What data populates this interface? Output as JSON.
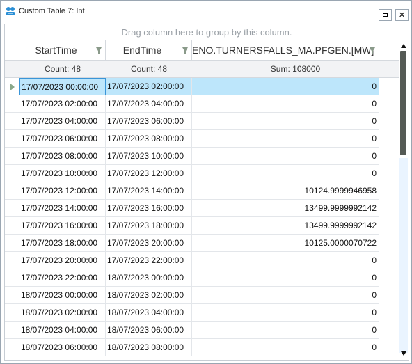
{
  "window": {
    "title": "Custom Table 7: Int",
    "close_glyph": "✕"
  },
  "grid": {
    "group_panel_text": "Drag column here to group by this column.",
    "columns": [
      {
        "label": "StartTime"
      },
      {
        "label": "EndTime"
      },
      {
        "label": "ENO.TURNERSFALLS_MA.PFGEN.[MW]"
      }
    ],
    "summary": [
      "Count: 48",
      "Count: 48",
      "Sum: 108000"
    ],
    "rows": [
      {
        "start": "17/07/2023 00:00:00",
        "end": "17/07/2023 02:00:00",
        "value": "0"
      },
      {
        "start": "17/07/2023 02:00:00",
        "end": "17/07/2023 04:00:00",
        "value": "0"
      },
      {
        "start": "17/07/2023 04:00:00",
        "end": "17/07/2023 06:00:00",
        "value": "0"
      },
      {
        "start": "17/07/2023 06:00:00",
        "end": "17/07/2023 08:00:00",
        "value": "0"
      },
      {
        "start": "17/07/2023 08:00:00",
        "end": "17/07/2023 10:00:00",
        "value": "0"
      },
      {
        "start": "17/07/2023 10:00:00",
        "end": "17/07/2023 12:00:00",
        "value": "0"
      },
      {
        "start": "17/07/2023 12:00:00",
        "end": "17/07/2023 14:00:00",
        "value": "10124.9999946958"
      },
      {
        "start": "17/07/2023 14:00:00",
        "end": "17/07/2023 16:00:00",
        "value": "13499.9999992142"
      },
      {
        "start": "17/07/2023 16:00:00",
        "end": "17/07/2023 18:00:00",
        "value": "13499.9999992142"
      },
      {
        "start": "17/07/2023 18:00:00",
        "end": "17/07/2023 20:00:00",
        "value": "10125.0000070722"
      },
      {
        "start": "17/07/2023 20:00:00",
        "end": "17/07/2023 22:00:00",
        "value": "0"
      },
      {
        "start": "17/07/2023 22:00:00",
        "end": "18/07/2023 00:00:00",
        "value": "0"
      },
      {
        "start": "18/07/2023 00:00:00",
        "end": "18/07/2023 02:00:00",
        "value": "0"
      },
      {
        "start": "18/07/2023 02:00:00",
        "end": "18/07/2023 04:00:00",
        "value": "0"
      },
      {
        "start": "18/07/2023 04:00:00",
        "end": "18/07/2023 06:00:00",
        "value": "0"
      },
      {
        "start": "18/07/2023 06:00:00",
        "end": "18/07/2023 08:00:00",
        "value": "0"
      }
    ],
    "selected_row": 0
  },
  "colors": {
    "selection": "#bde6fb",
    "selection_border": "#3a95d8",
    "filter_icon": "#8a9a8a"
  }
}
